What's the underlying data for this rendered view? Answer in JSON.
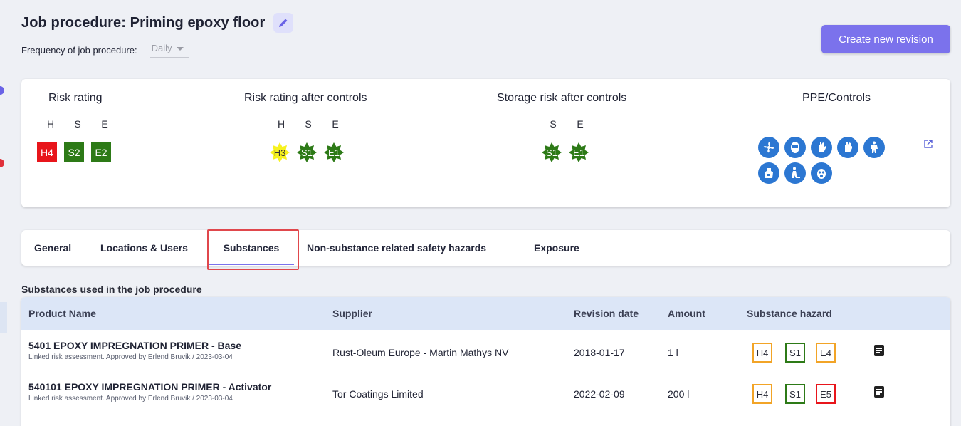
{
  "header": {
    "title": "Job procedure: Priming epoxy floor",
    "frequency_label": "Frequency of job procedure:",
    "frequency_value": "Daily"
  },
  "actions": {
    "create_revision": "Create new revision"
  },
  "risk": {
    "rating": {
      "heading": "Risk rating",
      "letters": [
        "H",
        "S",
        "E"
      ],
      "badges": [
        "H4",
        "S2",
        "E2"
      ]
    },
    "after_controls": {
      "heading": "Risk rating after controls",
      "letters": [
        "H",
        "S",
        "E"
      ],
      "badges": [
        "H3",
        "S1",
        "E1"
      ]
    },
    "storage": {
      "heading": "Storage risk after controls",
      "letters": [
        "S",
        "E"
      ],
      "badges": [
        "S1",
        "E1"
      ]
    },
    "ppe": {
      "heading": "PPE/Controls",
      "icons": [
        "ventilation-icon",
        "face-shield-icon",
        "glove-icon",
        "glove-icon",
        "protective-suit-icon",
        "apron-icon",
        "safety-footwear-icon",
        "respirator-icon"
      ]
    }
  },
  "colors": {
    "red": "#e8151b",
    "green": "#2d7a17",
    "yellow": "#f7f21f",
    "orange": "#f2a427",
    "accent": "#7b72ec",
    "ppe_blue": "#2c77d2"
  },
  "tabs": [
    {
      "label": "General"
    },
    {
      "label": "Locations & Users"
    },
    {
      "label": "Substances"
    },
    {
      "label": "Non-substance related safety hazards"
    },
    {
      "label": "Exposure"
    }
  ],
  "substances": {
    "section_title": "Substances used in the job procedure",
    "columns": [
      "Product Name",
      "Supplier",
      "Revision date",
      "Amount",
      "Substance hazard"
    ],
    "rows": [
      {
        "name": "5401 EPOXY IMPREGNATION PRIMER - Base",
        "note": "Linked risk assessment. Approved by Erlend Bruvik / 2023-03-04",
        "supplier": "Rust-Oleum Europe - Martin Mathys NV",
        "revision_date": "2018-01-17",
        "amount": "1 l",
        "hazards": [
          "H4",
          "S1",
          "E4"
        ]
      },
      {
        "name": "540101 EPOXY IMPREGNATION PRIMER - Activator",
        "note": "Linked risk assessment. Approved by Erlend Bruvik / 2023-03-04",
        "supplier": "Tor Coatings Limited",
        "revision_date": "2022-02-09",
        "amount": "200 l",
        "hazards": [
          "H4",
          "S1",
          "E5"
        ]
      }
    ]
  }
}
